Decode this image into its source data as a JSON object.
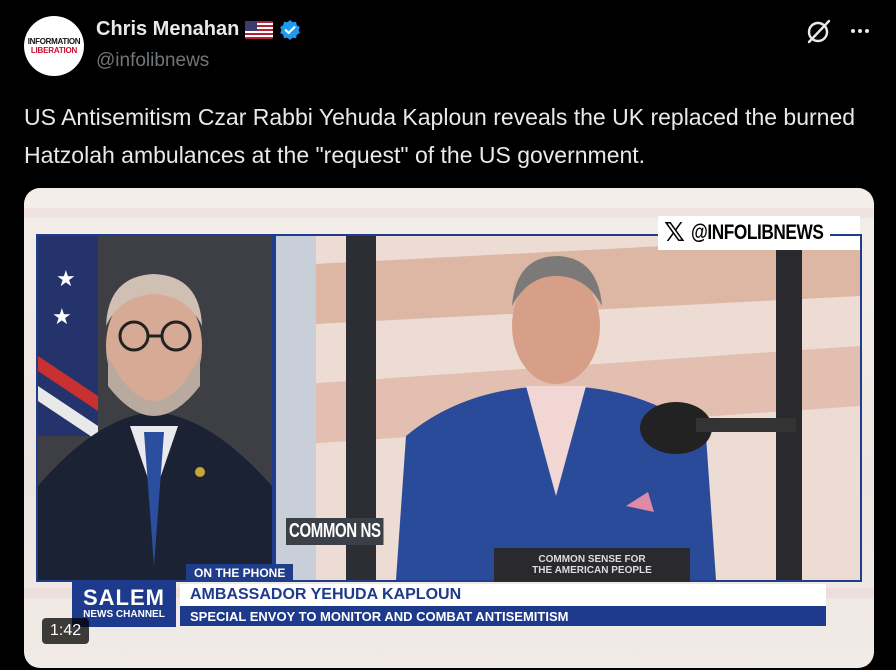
{
  "post": {
    "author": {
      "display_name": "Chris Menahan",
      "handle": "@infolibnews",
      "avatar_text_top": "INFORMATION",
      "avatar_text_bottom": "LIBERATION",
      "flag_icon": "us-flag-icon",
      "verified_icon": "verified-badge-icon"
    },
    "actions": {
      "grok_icon": "grok-icon",
      "more_icon": "more-options-icon"
    },
    "text": "US Antisemitism Czar Rabbi Yehuda Kaploun reveals the UK replaced the burned Hatzolah ambulances at the \"request\" of the US government."
  },
  "video": {
    "watermark_handle": "@INFOLIBNEWS",
    "watermark_icon": "x-logo-icon",
    "on_the_phone": "ON THE PHONE",
    "network_name": "SALEM",
    "network_sub": "NEWS CHANNEL",
    "guest_name": "AMBASSADOR YEHUDA KAPLOUN",
    "guest_title": "SPECIAL ENVOY TO MONITOR AND COMBAT ANTISEMITISM",
    "desk_sign_line1": "COMMON SENSE FOR",
    "desk_sign_line2": "THE AMERICAN PEOPLE",
    "background_text": "COMMON   NS",
    "duration": "1:42"
  },
  "colors": {
    "background": "#000000",
    "text_primary": "#e7e9ea",
    "text_secondary": "#71767b",
    "verified_blue": "#1d9bf0",
    "salem_blue": "#1d3a8c"
  }
}
